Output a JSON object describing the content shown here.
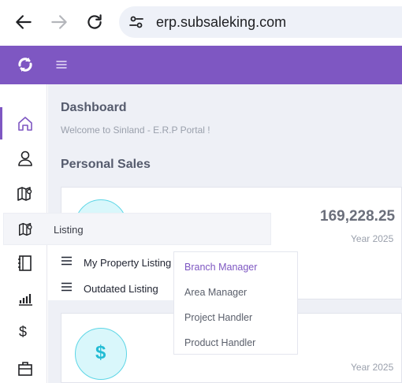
{
  "browser": {
    "url": "erp.subsaleking.com"
  },
  "page": {
    "title": "Dashboard",
    "welcome": "Welcome to Sinland - E.R.P Portal !",
    "section_title": "Personal Sales"
  },
  "stats": {
    "card1_value": "169,228.25",
    "card1_year": "Year 2025",
    "card2_year": "Year 2025",
    "card2_icon_symbol": "$"
  },
  "listing_menu": {
    "label": "Listing",
    "items": [
      {
        "label": "My Property Listing"
      },
      {
        "label": "Outdated Listing"
      }
    ]
  },
  "property_dropdown": {
    "items": [
      {
        "label": "Branch Manager",
        "active": true
      },
      {
        "label": "Area Manager"
      },
      {
        "label": "Project Handler"
      },
      {
        "label": "Product Handler"
      }
    ]
  },
  "sidebar": {
    "icons": [
      "home-icon",
      "user-icon",
      "map-icon",
      "map-icon",
      "notebook-icon",
      "bar-chart-icon",
      "dollar-icon",
      "briefcase-icon"
    ],
    "dollar_symbol": "$"
  },
  "colors": {
    "brand": "#7e57c2",
    "accent_cyan": "#23bcd4",
    "background": "#eef0f6"
  }
}
